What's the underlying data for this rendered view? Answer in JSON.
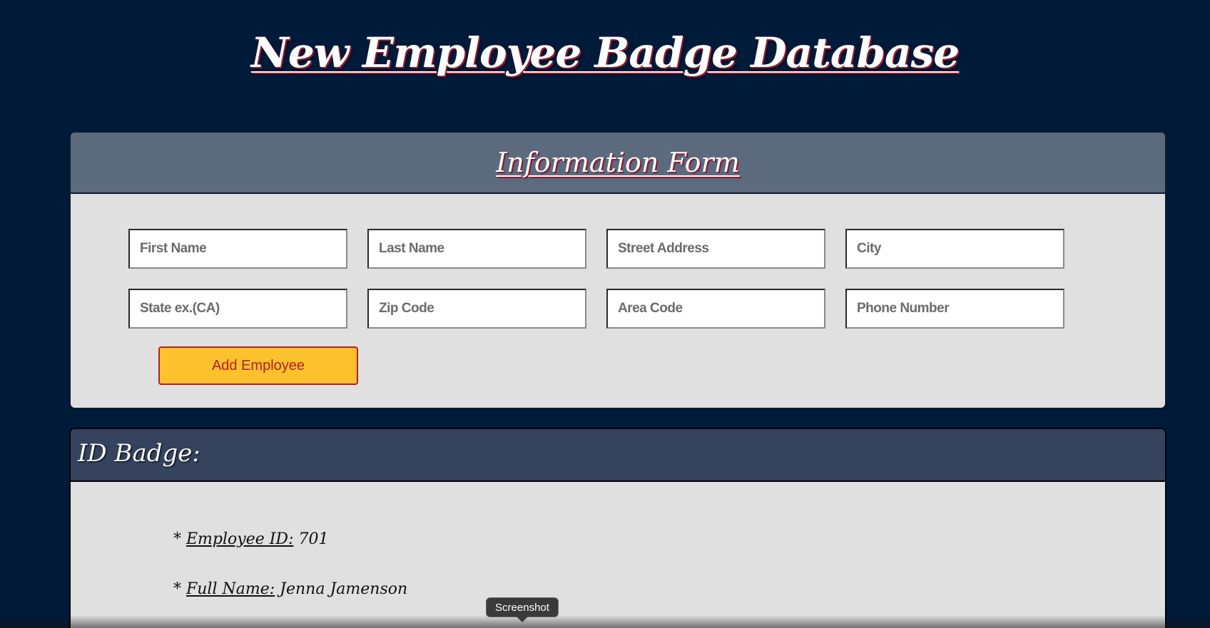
{
  "page": {
    "title": "New Employee Badge Database"
  },
  "form": {
    "title": "Information Form",
    "fields": [
      {
        "placeholder": "First Name",
        "value": ""
      },
      {
        "placeholder": "Last Name",
        "value": ""
      },
      {
        "placeholder": "Street Address",
        "value": ""
      },
      {
        "placeholder": "City",
        "value": ""
      },
      {
        "placeholder": "State ex.(CA)",
        "value": ""
      },
      {
        "placeholder": "Zip Code",
        "value": ""
      },
      {
        "placeholder": "Area Code",
        "value": ""
      },
      {
        "placeholder": "Phone Number",
        "value": ""
      }
    ],
    "add_button_label": "Add Employee"
  },
  "badge": {
    "title": "ID Badge:",
    "rows": [
      {
        "bullet": "*",
        "label": "Employee ID:",
        "value": "701"
      },
      {
        "bullet": "*",
        "label": "Full Name:",
        "value": "Jenna Jamenson"
      }
    ]
  },
  "tooltip": {
    "label": "Screenshot"
  },
  "colors": {
    "background": "#001a3a",
    "form_header": "#5c6a7e",
    "badge_header": "#35435e",
    "panel_body": "#e0e0e0",
    "button_fill": "#fbc22d",
    "button_text": "#b32020",
    "title_shadow": "#8a1a2e"
  }
}
